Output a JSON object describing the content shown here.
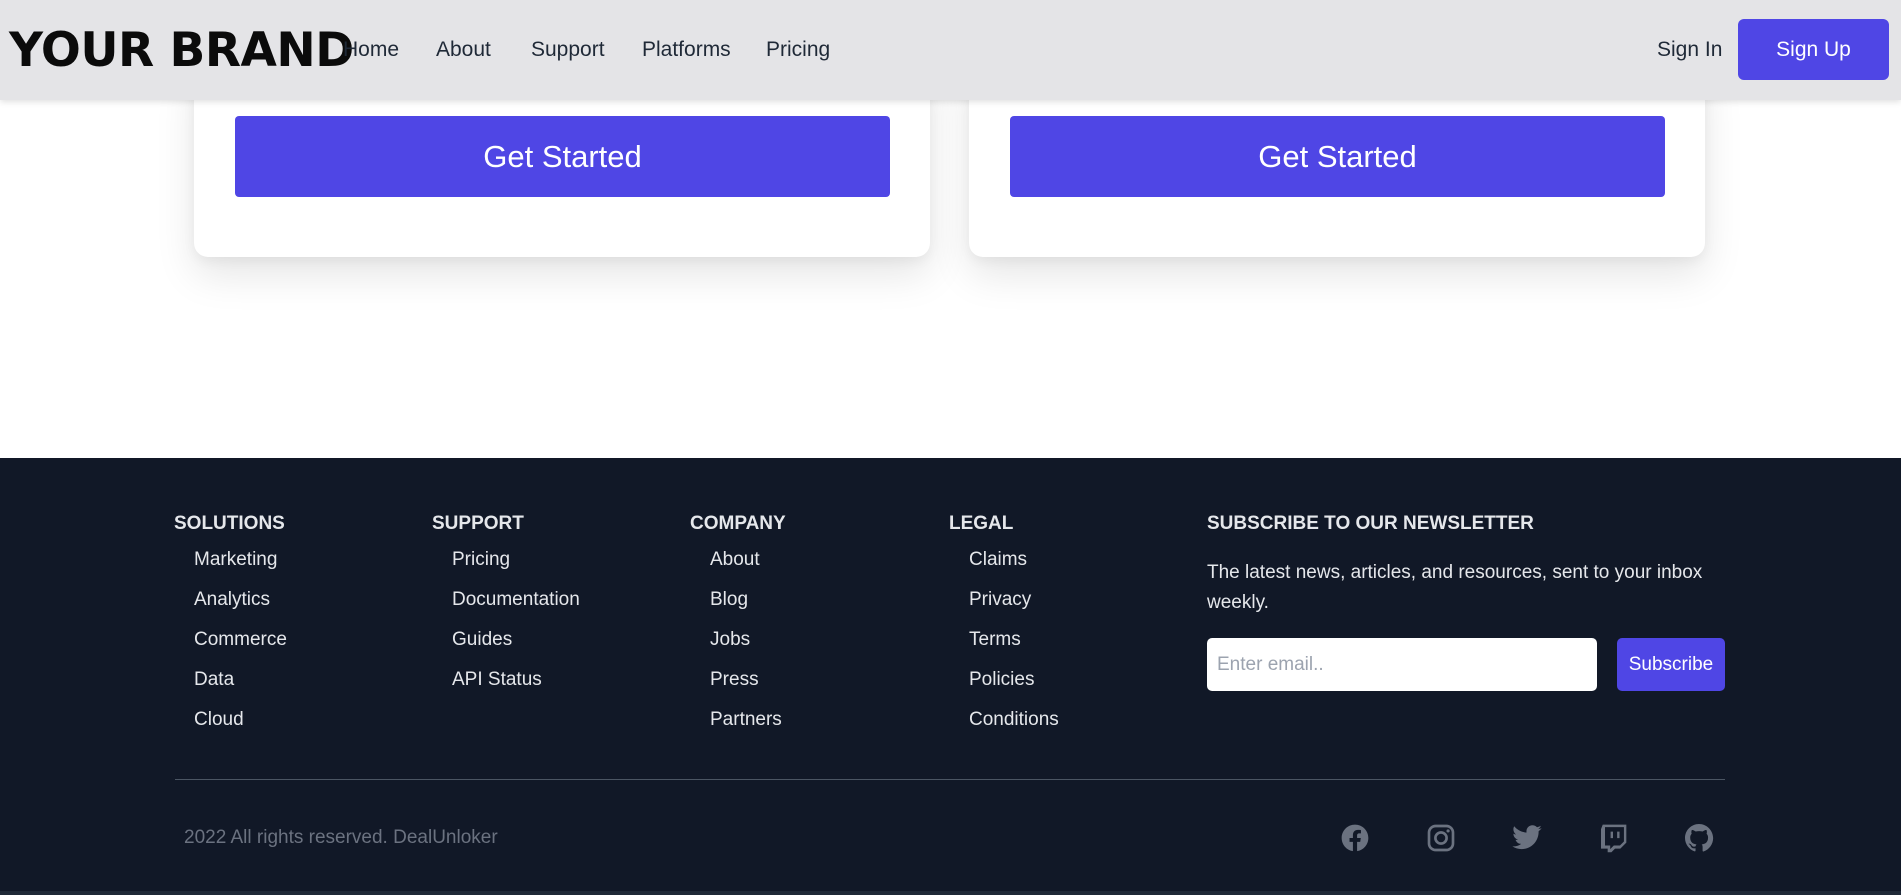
{
  "header": {
    "brand": "YOUR BRAND",
    "nav": [
      "Home",
      "About",
      "Support",
      "Platforms",
      "Pricing"
    ],
    "sign_in": "Sign In",
    "sign_up": "Sign Up"
  },
  "cards": [
    {
      "cta": "Get Started"
    },
    {
      "cta": "Get Started"
    }
  ],
  "footer": {
    "columns": [
      {
        "title": "SOLUTIONS",
        "links": [
          "Marketing",
          "Analytics",
          "Commerce",
          "Data",
          "Cloud"
        ]
      },
      {
        "title": "SUPPORT",
        "links": [
          "Pricing",
          "Documentation",
          "Guides",
          "API Status"
        ]
      },
      {
        "title": "COMPANY",
        "links": [
          "About",
          "Blog",
          "Jobs",
          "Press",
          "Partners"
        ]
      },
      {
        "title": "LEGAL",
        "links": [
          "Claims",
          "Privacy",
          "Terms",
          "Policies",
          "Conditions"
        ]
      }
    ],
    "newsletter": {
      "title": "SUBSCRIBE TO OUR NEWSLETTER",
      "description": "The latest news, articles, and resources, sent to your inbox weekly.",
      "email_placeholder": "Enter email..",
      "subscribe_label": "Subscribe"
    },
    "copyright": "2022 All rights reserved. DealUnloker",
    "social_icons": [
      "facebook-icon",
      "instagram-icon",
      "twitter-icon",
      "twitch-icon",
      "github-icon"
    ]
  },
  "colors": {
    "accent": "#4f46e5",
    "footer_bg": "#111827",
    "header_bg": "#e4e4e7",
    "social_icon": "#6b7280"
  }
}
